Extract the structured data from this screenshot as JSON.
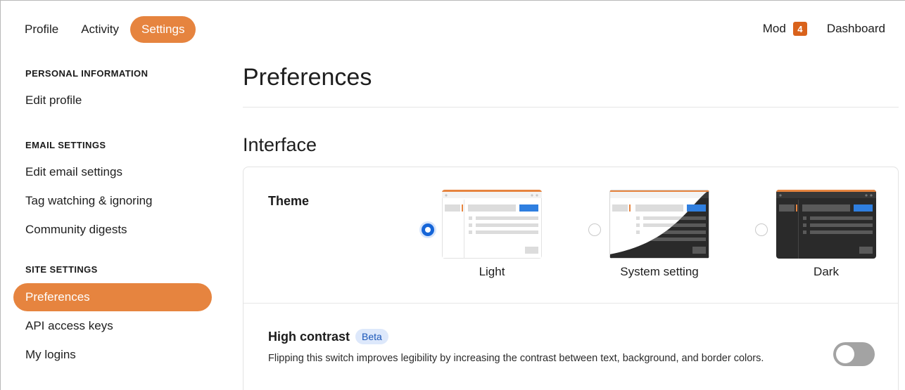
{
  "topnav": {
    "tabs": [
      {
        "label": "Profile"
      },
      {
        "label": "Activity"
      },
      {
        "label": "Settings"
      }
    ],
    "mod_label": "Mod",
    "mod_count": "4",
    "dashboard_label": "Dashboard"
  },
  "sidebar": {
    "personal_heading": "PERSONAL INFORMATION",
    "edit_profile": "Edit profile",
    "email_heading": "EMAIL SETTINGS",
    "edit_email": "Edit email settings",
    "tag_watching": "Tag watching & ignoring",
    "community_digests": "Community digests",
    "site_heading": "SITE SETTINGS",
    "preferences": "Preferences",
    "api_keys": "API access keys",
    "my_logins": "My logins"
  },
  "main": {
    "title": "Preferences",
    "subtitle": "Interface",
    "theme": {
      "label": "Theme",
      "options": [
        {
          "label": "Light",
          "selected": true
        },
        {
          "label": "System setting",
          "selected": false
        },
        {
          "label": "Dark",
          "selected": false
        }
      ]
    },
    "high_contrast": {
      "title": "High contrast",
      "badge": "Beta",
      "description": "Flipping this switch improves legibility by increasing the contrast between text, background, and border colors.",
      "enabled": false
    }
  },
  "colors": {
    "accent": "#e6843f",
    "badge": "#d9621b",
    "radio_selected": "#1565d8",
    "toggle_off": "#a3a3a3"
  }
}
